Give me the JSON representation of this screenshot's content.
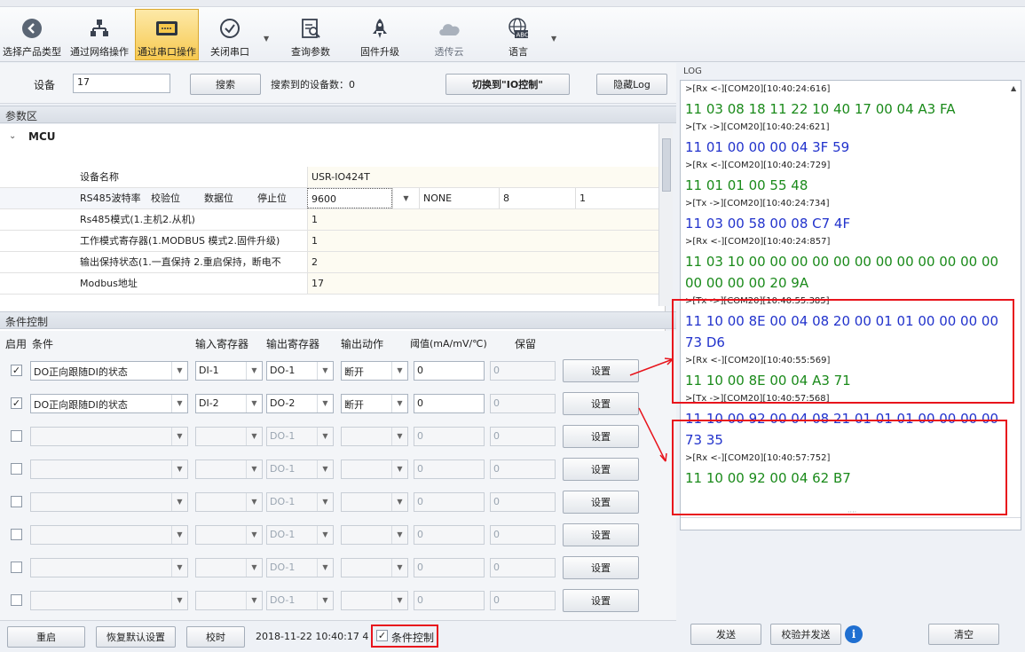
{
  "toolbar": {
    "items": [
      {
        "label": "选择产品类型",
        "icon": "back-circle-icon"
      },
      {
        "label": "通过网络操作",
        "icon": "network-icon"
      },
      {
        "label": "通过串口操作",
        "icon": "serial-port-icon"
      },
      {
        "label": "关闭串口",
        "icon": "check-circle-icon"
      },
      {
        "label": "查询参数",
        "icon": "query-doc-icon"
      },
      {
        "label": "固件升级",
        "icon": "rocket-icon"
      },
      {
        "label": "透传云",
        "icon": "cloud-icon"
      },
      {
        "label": "语言",
        "icon": "globe-abc-icon"
      }
    ]
  },
  "search": {
    "device_label": "设备",
    "device_value": "17",
    "search_button": "搜索",
    "found_label": "搜索到的设备数：0",
    "switch_button": "切换到\"IO控制\"",
    "hide_log_button": "隐藏Log"
  },
  "params": {
    "section_title": "参数区",
    "group": "MCU",
    "rows": [
      {
        "name": "设备名称",
        "value": "USR-IO424T"
      },
      {
        "name": "Rs485模式(1.主机2.从机)",
        "value": "1"
      },
      {
        "name": "工作模式寄存器(1.MODBUS 模式2.固件升级)",
        "value": "1"
      },
      {
        "name": "输出保持状态(1.一直保持 2.重启保持，断电不",
        "value": "2"
      },
      {
        "name": "Modbus地址",
        "value": "17"
      }
    ],
    "rs485": {
      "headers": [
        "RS485波特率",
        "校验位",
        "数据位",
        "停止位"
      ],
      "baud": "9600",
      "parity": "NONE",
      "databits": "8",
      "stopbits": "1"
    }
  },
  "conditions": {
    "section_title": "条件控制",
    "headers": {
      "enable": "启用",
      "condition": "条件",
      "input": "输入寄存器",
      "output": "输出寄存器",
      "action": "输出动作",
      "threshold": "阈值(mA/mV/℃)",
      "reserve": "保留"
    },
    "rows": [
      {
        "checked": "✓",
        "condition": "DO正向跟随DI的状态",
        "input": "DI-1",
        "output": "DO-1",
        "action": "断开",
        "threshold": "0",
        "reserve": "0",
        "button": "设置"
      },
      {
        "checked": "✓",
        "condition": "DO正向跟随DI的状态",
        "input": "DI-2",
        "output": "DO-2",
        "action": "断开",
        "threshold": "0",
        "reserve": "0",
        "button": "设置"
      },
      {
        "checked": "",
        "condition": "",
        "input": "",
        "output": "DO-1",
        "action": "",
        "threshold": "0",
        "reserve": "0",
        "button": "设置"
      },
      {
        "checked": "",
        "condition": "",
        "input": "",
        "output": "DO-1",
        "action": "",
        "threshold": "0",
        "reserve": "0",
        "button": "设置"
      },
      {
        "checked": "",
        "condition": "",
        "input": "",
        "output": "DO-1",
        "action": "",
        "threshold": "0",
        "reserve": "0",
        "button": "设置"
      },
      {
        "checked": "",
        "condition": "",
        "input": "",
        "output": "DO-1",
        "action": "",
        "threshold": "0",
        "reserve": "0",
        "button": "设置"
      },
      {
        "checked": "",
        "condition": "",
        "input": "",
        "output": "DO-1",
        "action": "",
        "threshold": "0",
        "reserve": "0",
        "button": "设置"
      },
      {
        "checked": "",
        "condition": "",
        "input": "",
        "output": "DO-1",
        "action": "",
        "threshold": "0",
        "reserve": "0",
        "button": "设置"
      }
    ]
  },
  "bottom": {
    "restart": "重启",
    "restore": "恢复默认设置",
    "sync_time": "校时",
    "datetime": "2018-11-22 10:40:17 4",
    "cond_check": "✓",
    "cond_label": "条件控制"
  },
  "log": {
    "title": "LOG",
    "lines": [
      {
        "kind": "meta",
        "text": ">[Rx <-][COM20][10:40:24:616]"
      },
      {
        "kind": "rx",
        "text": "11 03 08 18 11 22 10 40 17 00 04 A3 FA"
      },
      {
        "kind": "meta",
        "text": ">[Tx ->][COM20][10:40:24:621]"
      },
      {
        "kind": "tx",
        "text": "11 01 00 00 00 04 3F 59"
      },
      {
        "kind": "meta",
        "text": ">[Rx <-][COM20][10:40:24:729]"
      },
      {
        "kind": "rx",
        "text": "11 01 01 00 55 48"
      },
      {
        "kind": "meta",
        "text": ">[Tx ->][COM20][10:40:24:734]"
      },
      {
        "kind": "tx",
        "text": "11 03 00 58 00 08 C7 4F"
      },
      {
        "kind": "meta",
        "text": ">[Rx <-][COM20][10:40:24:857]"
      },
      {
        "kind": "rx",
        "text": "11 03 10 00 00 00 00 00 00 00 00 00 00 00 00"
      },
      {
        "kind": "rx",
        "text": "00 00 00 00 20 9A"
      },
      {
        "kind": "meta",
        "text": ">[Tx ->][COM20][10:40:55:385]"
      },
      {
        "kind": "tx",
        "text": "11 10 00 8E 00 04 08 20 00 01 01 00 00 00 00"
      },
      {
        "kind": "tx",
        "text": "73 D6"
      },
      {
        "kind": "meta",
        "text": ">[Rx <-][COM20][10:40:55:569]"
      },
      {
        "kind": "rx",
        "text": "11 10 00 8E 00 04 A3 71"
      },
      {
        "kind": "meta",
        "text": ">[Tx ->][COM20][10:40:57:568]"
      },
      {
        "kind": "tx",
        "text": "11 10 00 92 00 04 08 21 01 01 01 00 00 00 00"
      },
      {
        "kind": "tx",
        "text": "73 35"
      },
      {
        "kind": "meta",
        "text": ">[Rx <-][COM20][10:40:57:752]"
      },
      {
        "kind": "rx",
        "text": "11 10 00 92 00 04 62 B7"
      }
    ],
    "send": "发送",
    "check_send": "校验并发送",
    "clear": "清空"
  }
}
